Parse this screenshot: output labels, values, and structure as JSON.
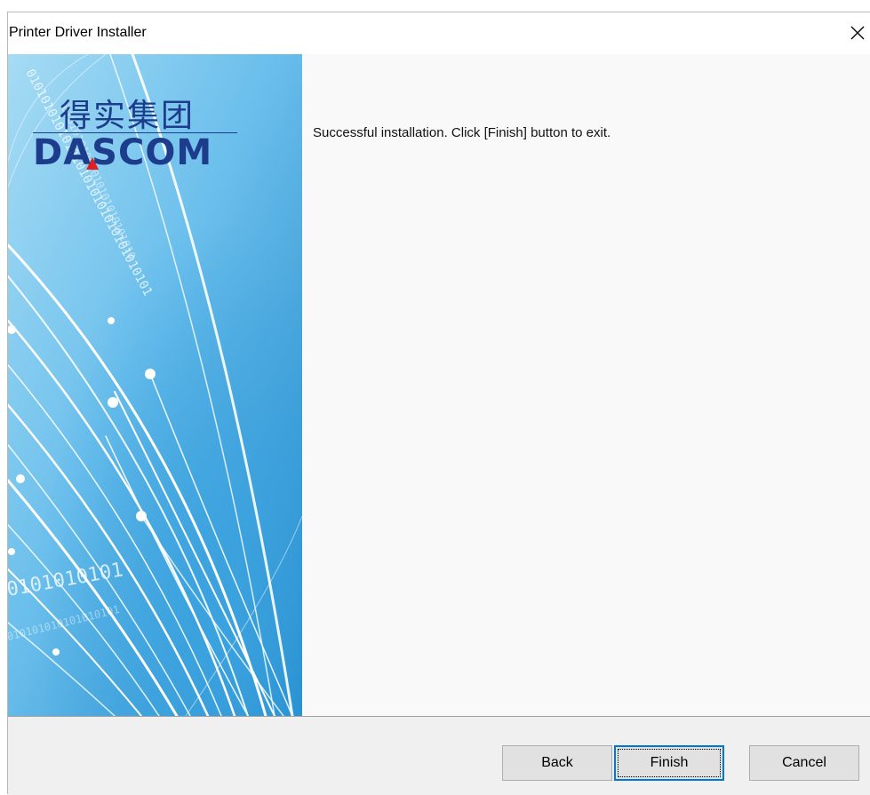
{
  "window": {
    "title": "Printer Driver Installer",
    "close_icon": "close-icon"
  },
  "banner": {
    "logo_cn": "得实集团",
    "logo_en": "DASCOM",
    "digits_text": "0101010101010101",
    "colors": {
      "sky_top": "#7ec8ef",
      "sky_bottom": "#2a8fcf",
      "logo": "#1e3c8c",
      "accent": "#e02020"
    }
  },
  "content": {
    "message": "Successful installation. Click [Finish] button to exit."
  },
  "buttons": {
    "back": "Back",
    "finish": "Finish",
    "cancel": "Cancel"
  },
  "colors": {
    "focus_border": "#0078d7",
    "button_bg": "#e1e1e1",
    "footer_bg": "#f0f0f0"
  }
}
